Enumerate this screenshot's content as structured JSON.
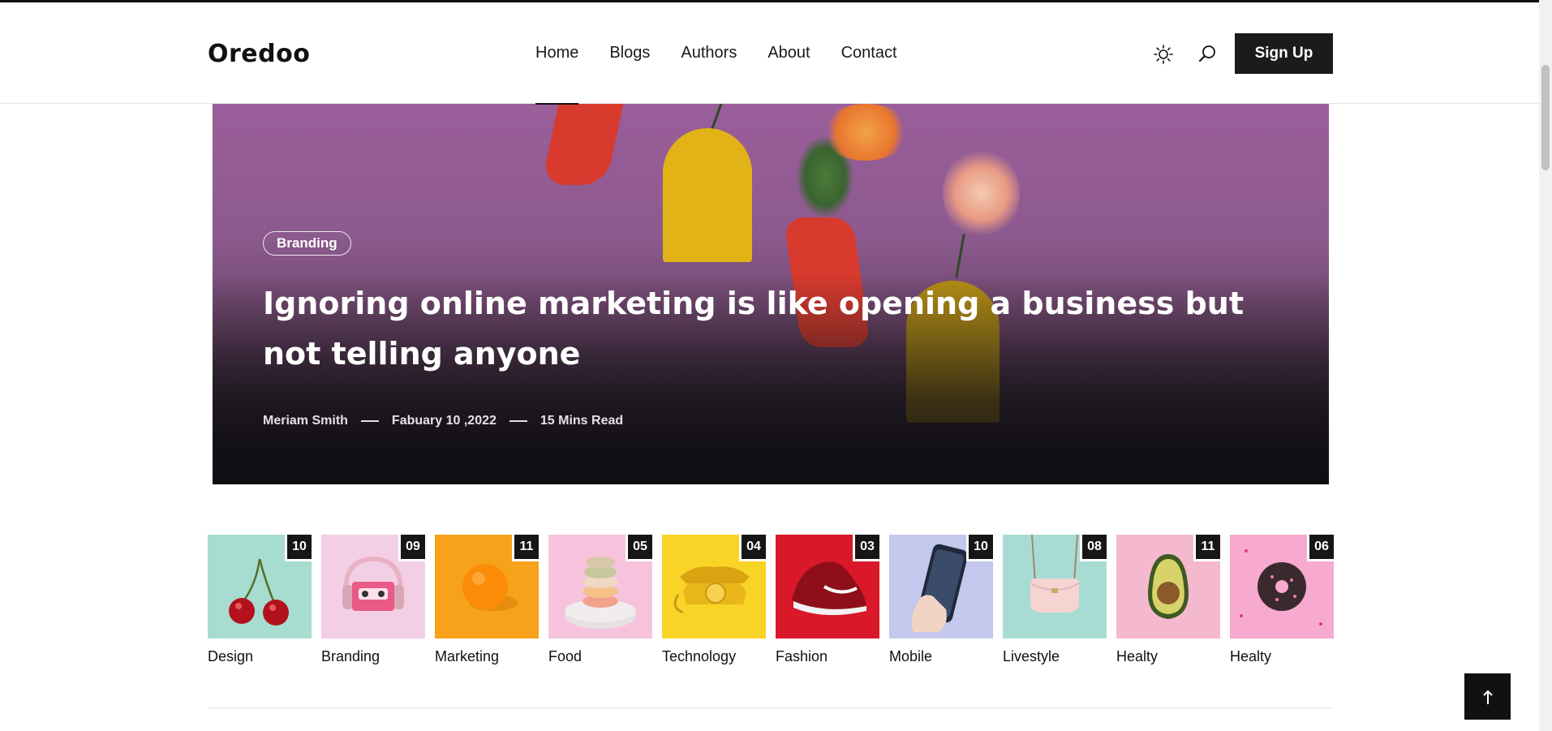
{
  "header": {
    "logo": "Oredoo",
    "nav": [
      {
        "label": "Home",
        "active": true
      },
      {
        "label": "Blogs",
        "active": false
      },
      {
        "label": "Authors",
        "active": false
      },
      {
        "label": "About",
        "active": false
      },
      {
        "label": "Contact",
        "active": false
      }
    ],
    "theme_icon": "sun-icon",
    "search_icon": "search-icon",
    "signup_label": "Sign Up"
  },
  "hero": {
    "category": "Branding",
    "title": "Ignoring online marketing is like opening a business but not telling anyone",
    "author": "Meriam Smith",
    "date": "Fabuary 10 ,2022",
    "read_time": "15 Mins Read"
  },
  "categories": [
    {
      "label": "Design",
      "count": "10",
      "bg": "#a7ddd0"
    },
    {
      "label": "Branding",
      "count": "09",
      "bg": "#f3cfe6"
    },
    {
      "label": "Marketing",
      "count": "11",
      "bg": "#f6a21a"
    },
    {
      "label": "Food",
      "count": "05",
      "bg": "#f6c2dc"
    },
    {
      "label": "Technology",
      "count": "04",
      "bg": "#f8d426"
    },
    {
      "label": "Fashion",
      "count": "03",
      "bg": "#d9182a"
    },
    {
      "label": "Mobile",
      "count": "10",
      "bg": "#c4c8ec"
    },
    {
      "label": "Livestyle",
      "count": "08",
      "bg": "#a8dcd2"
    },
    {
      "label": "Healty",
      "count": "11",
      "bg": "#f4b9cf"
    },
    {
      "label": "Healty",
      "count": "06",
      "bg": "#f7a9d0"
    }
  ],
  "scroll_top_icon": "arrow-up-icon"
}
